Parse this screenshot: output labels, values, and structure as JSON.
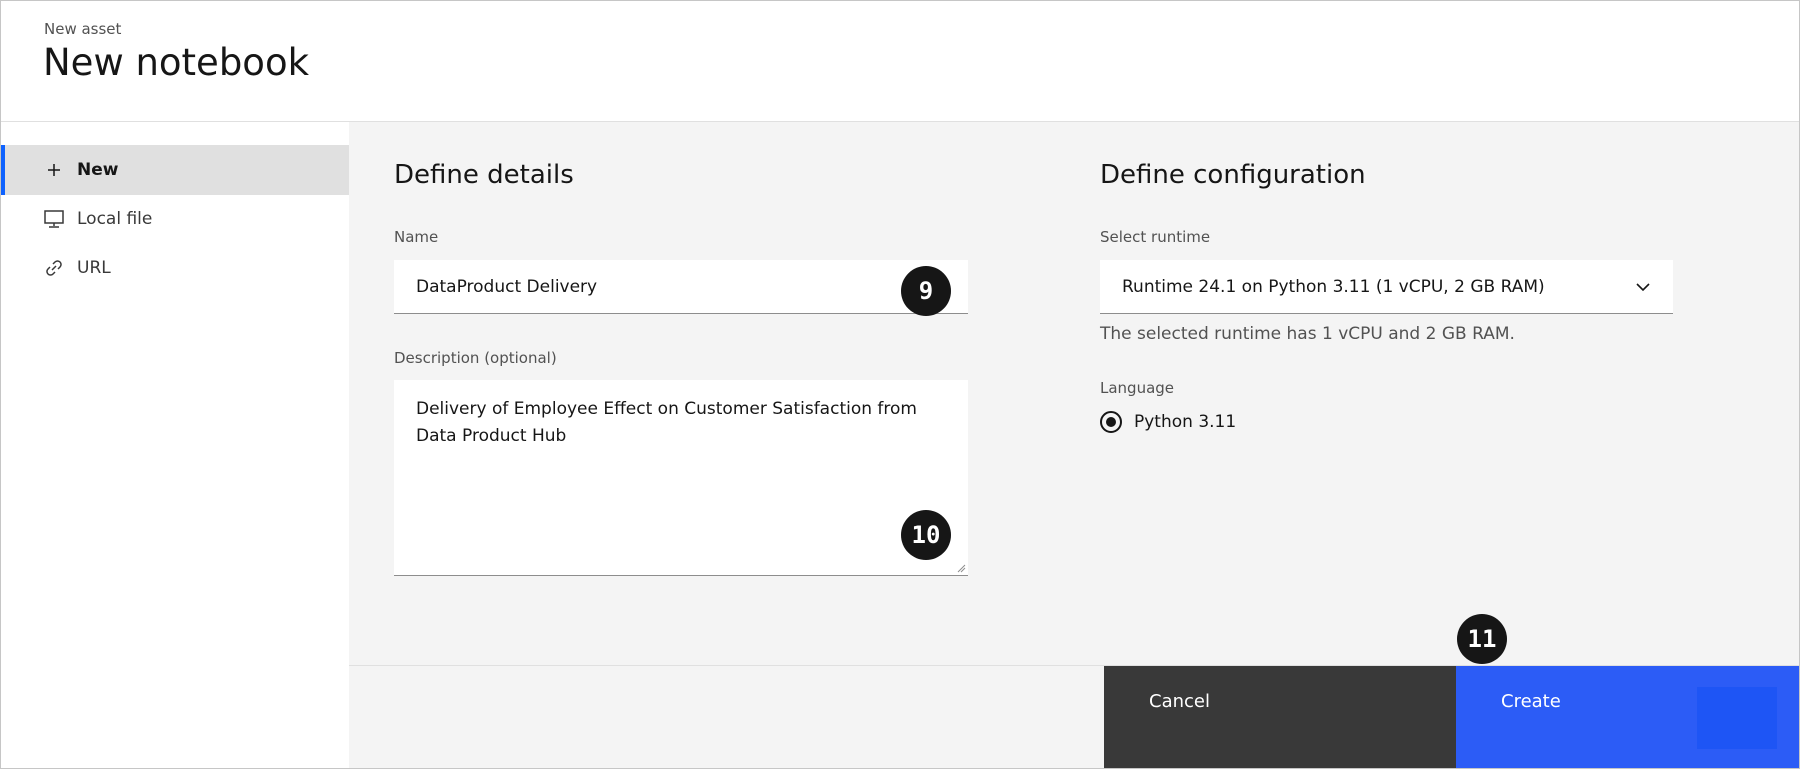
{
  "header": {
    "eyebrow": "New asset",
    "title": "New notebook"
  },
  "sidebar": {
    "items": [
      {
        "label": "New",
        "icon": "plus-icon",
        "active": true
      },
      {
        "label": "Local file",
        "icon": "monitor-icon",
        "active": false
      },
      {
        "label": "URL",
        "icon": "link-icon",
        "active": false
      }
    ]
  },
  "details": {
    "section_title": "Define details",
    "name_label": "Name",
    "name_value": "DataProduct Delivery",
    "description_label": "Description (optional)",
    "description_line1": "Delivery of Employee Effect on Customer Satisfaction from",
    "description_line2": "Data Product Hub"
  },
  "configuration": {
    "section_title": "Define configuration",
    "runtime_label": "Select runtime",
    "runtime_value": "Runtime 24.1 on Python 3.11 (1 vCPU, 2 GB RAM)",
    "runtime_helper": "The selected runtime has 1 vCPU and 2 GB RAM.",
    "language_label": "Language",
    "language_option": "Python 3.11"
  },
  "footer": {
    "cancel_label": "Cancel",
    "create_label": "Create"
  },
  "badges": {
    "b9": "9",
    "b10": "10",
    "b11": "11"
  },
  "colors": {
    "accent": "#0f62fe",
    "create_button": "#2c5cf6",
    "cancel_button": "#393939"
  }
}
